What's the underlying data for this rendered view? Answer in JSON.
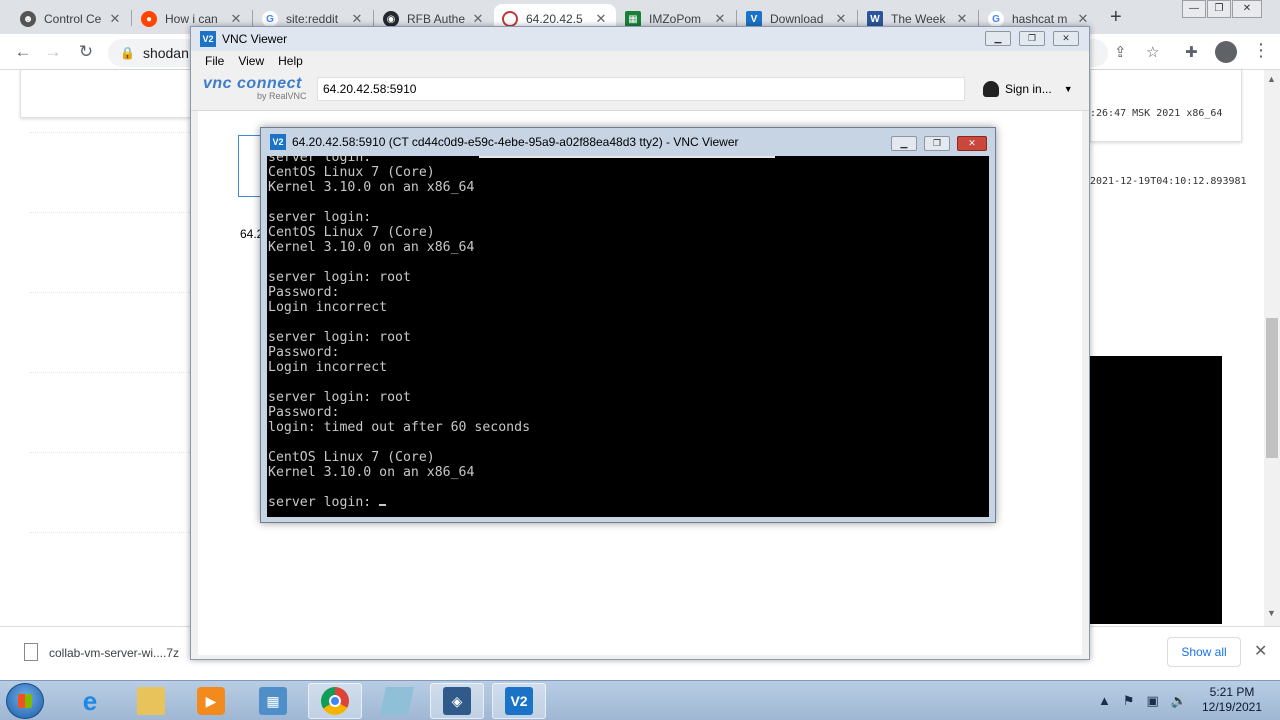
{
  "browser": {
    "tabs": [
      {
        "label": "Control Ce",
        "icon": "puppet-icon",
        "color": "#555555"
      },
      {
        "label": "How i can",
        "icon": "reddit-icon",
        "color": "#ff4500"
      },
      {
        "label": "site:reddit",
        "icon": "google-icon",
        "color": "#4285f4"
      },
      {
        "label": "RFB Authe",
        "icon": "github-icon",
        "color": "#24292e"
      },
      {
        "label": "64.20.42.5",
        "icon": "shodan-icon",
        "color": "#be3a3a"
      },
      {
        "label": "IMZoPom",
        "icon": "sheet-icon",
        "color": "#188038"
      },
      {
        "label": "Download",
        "icon": "vnc-icon",
        "color": "#1a73c6"
      },
      {
        "label": "The Week",
        "icon": "word-icon",
        "color": "#2b579a"
      },
      {
        "label": "hashcat m",
        "icon": "google-icon",
        "color": "#4285f4"
      }
    ],
    "address": "shodan.",
    "right_text_1": ":26:47 MSK 2021 x86_64",
    "right_text_2": "2021-12-19T04:10:12.893981"
  },
  "download_bar": {
    "filename": "collab-vm-server-wi....7z",
    "show_all": "Show all"
  },
  "vnc_main": {
    "title": "VNC Viewer",
    "menu": [
      "File",
      "View",
      "Help"
    ],
    "brand_main": "vnc connect",
    "brand_sub": "by RealVNC",
    "address": "64.20.42.58:5910",
    "sign_in": "Sign in...",
    "thumb_label": "64.2"
  },
  "vnc_session": {
    "title": "64.20.42.58:5910 (CT cd44c0d9-e59c-4ebe-95a9-a02f88ea48d3 tty2) - VNC Viewer",
    "terminal_lines": [
      "server login:",
      "CentOS Linux 7 (Core)",
      "Kernel 3.10.0 on an x86_64",
      "",
      "server login:",
      "CentOS Linux 7 (Core)",
      "Kernel 3.10.0 on an x86_64",
      "",
      "server login: root",
      "Password:",
      "Login incorrect",
      "",
      "server login: root",
      "Password:",
      "Login incorrect",
      "",
      "server login: root",
      "Password:",
      "login: timed out after 60 seconds",
      "",
      "CentOS Linux 7 (Core)",
      "Kernel 3.10.0 on an x86_64",
      "",
      "server login: "
    ]
  },
  "taskbar": {
    "apps": [
      "ie-icon",
      "explorer-icon",
      "media-player-icon",
      "control-panel-icon",
      "chrome-icon",
      "notepad-icon",
      "virtualbox-icon",
      "vnc-viewer-icon"
    ],
    "time": "5:21 PM",
    "date": "12/19/2021"
  }
}
